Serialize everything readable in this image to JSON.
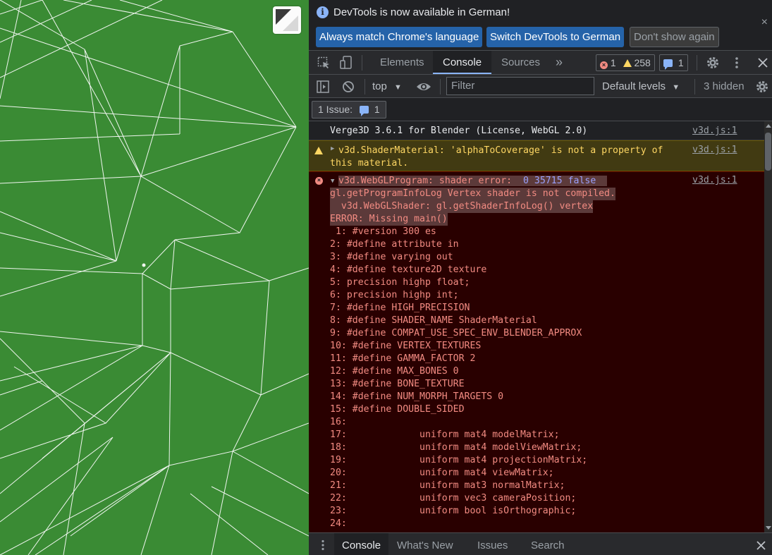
{
  "infobar": {
    "message": "DevTools is now available in German!",
    "buttons": [
      "Always match Chrome's language",
      "Switch DevTools to German",
      "Don't show again"
    ],
    "close_symbol": "×"
  },
  "maintabs": {
    "tabs": [
      "Elements",
      "Console",
      "Sources"
    ],
    "active": "Console",
    "more_symbol": "»",
    "error_count": "1",
    "warning_count": "258",
    "message_count": "1"
  },
  "toolbar": {
    "context": "top",
    "filter_placeholder": "Filter",
    "levels": "Default levels",
    "hidden": "3 hidden"
  },
  "issues": {
    "label": "1 Issue:",
    "count": "1"
  },
  "console": {
    "info_message": "Verge3D 3.6.1 for Blender (License, WebGL 2.0)",
    "info_source": "v3d.js:1",
    "warn_message": "v3d.ShaderMaterial: 'alphaToCoverage' is not a property of this material.",
    "warn_source": "v3d.js:1",
    "error_source": "v3d.js:1",
    "error_head": [
      "v3d.WebGLProgram: shader error:  ",
      "0",
      " ",
      "35715",
      " ",
      "false"
    ],
    "error_lines": [
      "gl.getProgramInfoLog Vertex shader is not compiled.",
      "  v3d.WebGLShader: gl.getShaderInfoLog() vertex",
      "ERROR: Missing main()",
      " 1: #version 300 es",
      "2: #define attribute in",
      "3: #define varying out",
      "4: #define texture2D texture",
      "5: precision highp float;",
      "6: precision highp int;",
      "7: #define HIGH_PRECISION",
      "8: #define SHADER_NAME ShaderMaterial",
      "9: #define COMPAT_USE_SPEC_ENV_BLENDER_APPROX",
      "10: #define VERTEX_TEXTURES",
      "11: #define GAMMA_FACTOR 2",
      "12: #define MAX_BONES 0",
      "13: #define BONE_TEXTURE",
      "14: #define NUM_MORPH_TARGETS 0",
      "15: #define DOUBLE_SIDED",
      "16:",
      "17:             uniform mat4 modelMatrix;",
      "18:             uniform mat4 modelViewMatrix;",
      "19:             uniform mat4 projectionMatrix;",
      "20:             uniform mat4 viewMatrix;",
      "21:             uniform mat3 normalMatrix;",
      "22:             uniform vec3 cameraPosition;",
      "23:             uniform bool isOrthographic;",
      "24:"
    ]
  },
  "drawer": {
    "tabs": [
      "Console",
      "What's New",
      "Issues",
      "Search"
    ],
    "active": "Console"
  },
  "colors": {
    "viewport_green": "#3a8b34",
    "devtools_bg": "#202124",
    "error_bg": "#290000",
    "warn_bg": "#413a12",
    "accent": "#8ab4f8"
  }
}
